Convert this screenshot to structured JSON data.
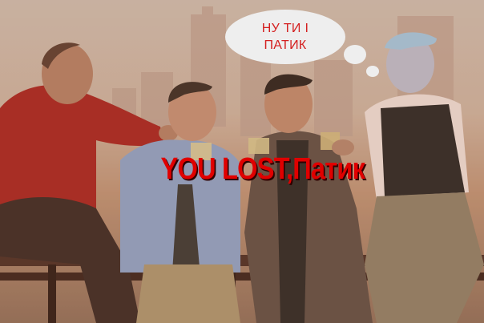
{
  "thought_bubble": {
    "line1": "НУ ТИ І",
    "line2": "ПАТИК"
  },
  "caption": {
    "text": "YOU LOST,Патик"
  },
  "colors": {
    "caption_red": "#e00000",
    "bubble_text_red": "#d42020",
    "sky": "#c8b6a9"
  }
}
